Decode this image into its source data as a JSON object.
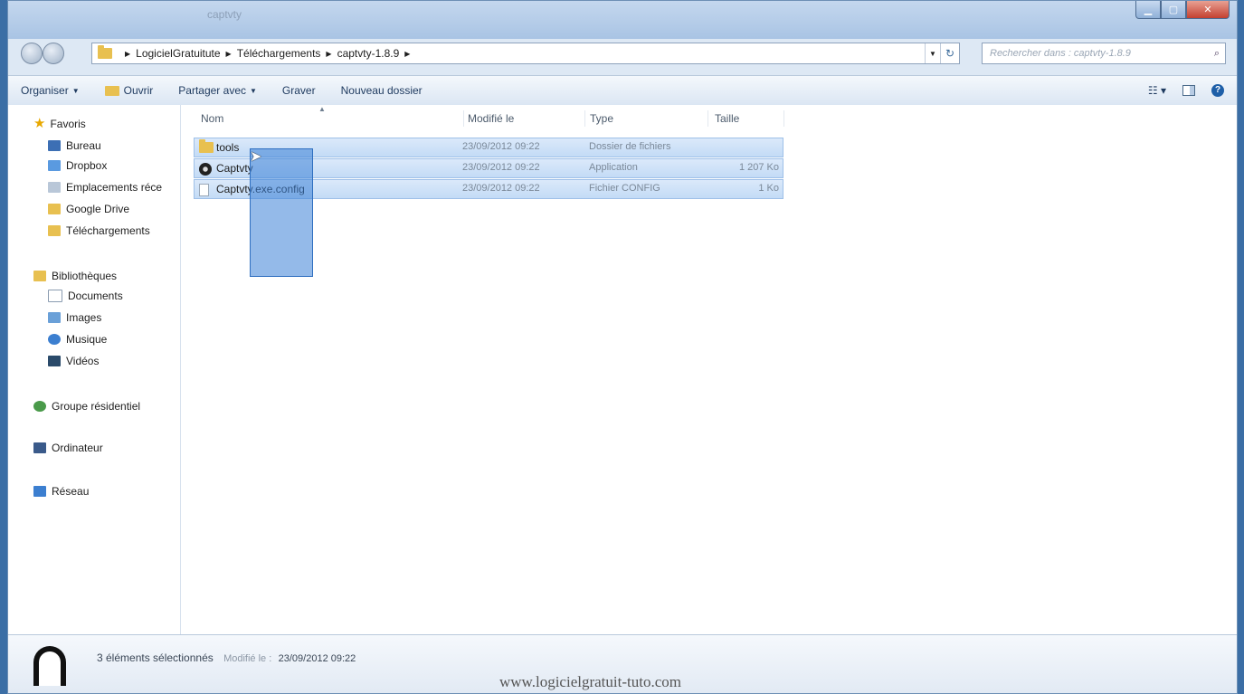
{
  "window": {
    "title": "captvty"
  },
  "address": {
    "crumbs": [
      "LogicielGratuitute",
      "Téléchargements",
      "captvty-1.8.9"
    ]
  },
  "search": {
    "placeholder": "Rechercher dans : captvty-1.8.9"
  },
  "toolbar": {
    "organize": "Organiser",
    "open": "Ouvrir",
    "share": "Partager avec",
    "burn": "Graver",
    "new_folder": "Nouveau dossier"
  },
  "nav": {
    "favorites": {
      "label": "Favoris",
      "items": [
        "Bureau",
        "Dropbox",
        "Emplacements réce",
        "Google Drive",
        "Téléchargements"
      ]
    },
    "libraries": {
      "label": "Bibliothèques",
      "items": [
        "Documents",
        "Images",
        "Musique",
        "Vidéos"
      ]
    },
    "homegroup": "Groupe résidentiel",
    "computer": "Ordinateur",
    "network": "Réseau"
  },
  "columns": {
    "name": "Nom",
    "modified": "Modifié le",
    "type": "Type",
    "size": "Taille"
  },
  "files": [
    {
      "name": "tools",
      "modified": "23/09/2012 09:22",
      "type": "Dossier de fichiers",
      "size": "",
      "icon": "folder-icon"
    },
    {
      "name": "Captvty",
      "modified": "23/09/2012 09:22",
      "type": "Application",
      "size": "1 207 Ko",
      "icon": "app-icon"
    },
    {
      "name": "Captvty.exe.config",
      "modified": "23/09/2012 09:22",
      "type": "Fichier CONFIG",
      "size": "1 Ko",
      "icon": "file-icon"
    }
  ],
  "details": {
    "count": "3 éléments sélectionnés",
    "modified_label": "Modifié le :",
    "modified_value": "23/09/2012 09:22"
  },
  "watermark": "www.logicielgratuit-tuto.com",
  "colors": {
    "selection": "#c3dbf6",
    "accent": "#1e5fa8"
  }
}
